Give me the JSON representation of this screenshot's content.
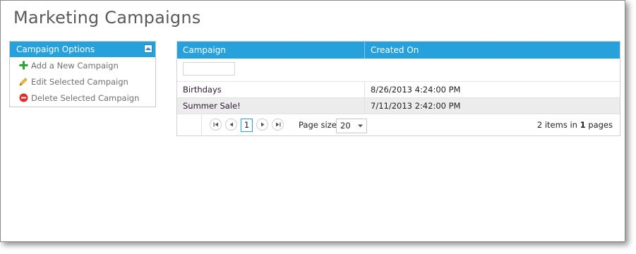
{
  "page": {
    "title": "Marketing Campaigns"
  },
  "options_panel": {
    "header": "Campaign Options",
    "items": [
      {
        "label": "Add a New Campaign",
        "icon": "plus-icon"
      },
      {
        "label": "Edit Selected Campaign",
        "icon": "pencil-icon"
      },
      {
        "label": "Delete Selected Campaign",
        "icon": "delete-icon"
      }
    ]
  },
  "grid": {
    "columns": [
      "Campaign",
      "Created On"
    ],
    "filter_value": "",
    "rows": [
      {
        "campaign": "Birthdays",
        "created_on": "8/26/2013 4:24:00 PM"
      },
      {
        "campaign": "Summer Sale!",
        "created_on": "7/11/2013 2:42:00 PM"
      }
    ],
    "pager": {
      "current_page": "1",
      "page_size_label": "Page size:",
      "page_size_value": "20",
      "info_prefix": "2 items in ",
      "info_pages": "1",
      "info_suffix": " pages"
    }
  },
  "colors": {
    "accent": "#27a1dc",
    "alt_row": "#ececec"
  }
}
